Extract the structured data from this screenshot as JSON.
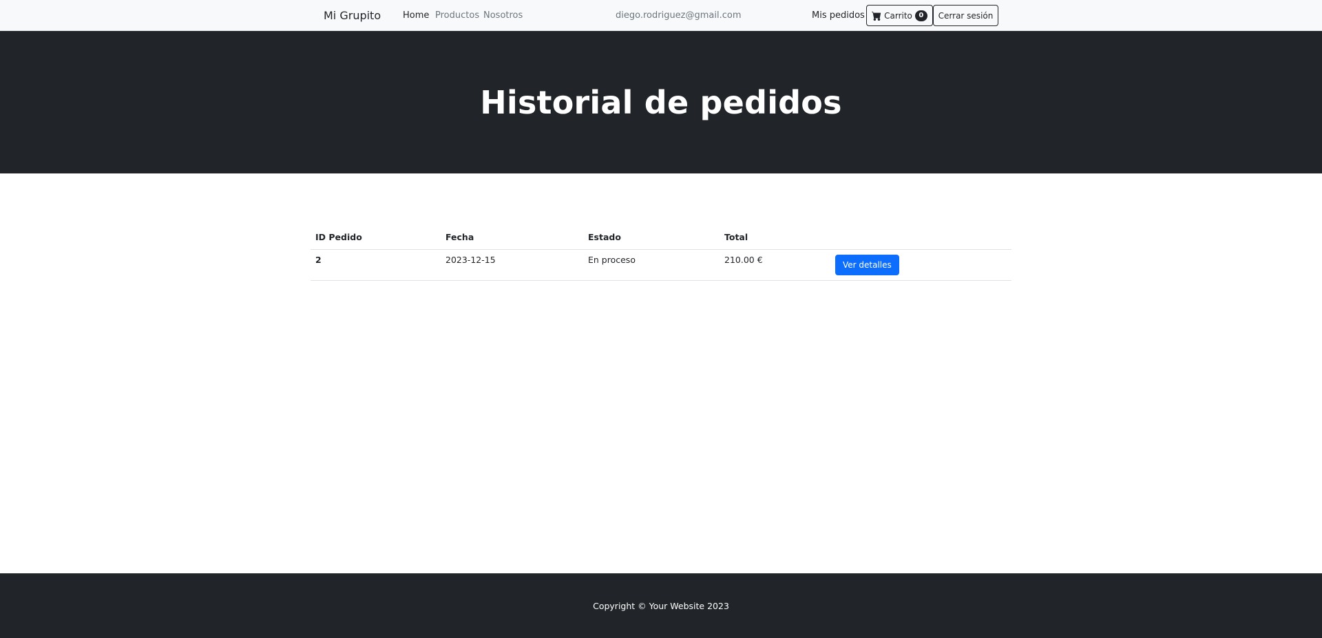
{
  "navbar": {
    "brand": "Mi Grupito",
    "links": [
      {
        "label": "Home",
        "active": true
      },
      {
        "label": "Productos",
        "active": false
      },
      {
        "label": "Nosotros",
        "active": false
      }
    ],
    "user_email": "diego.rodriguez@gmail.com",
    "orders_link": "Mis pedidos",
    "cart": {
      "label": "Carrito",
      "count": "0",
      "icon": "cart-icon"
    },
    "logout_label": "Cerrar sesión"
  },
  "header": {
    "title": "Historial de pedidos",
    "background": "#212529"
  },
  "orders_table": {
    "columns": [
      "ID Pedido",
      "Fecha",
      "Estado",
      "Total",
      ""
    ],
    "rows": [
      {
        "id": "2",
        "date": "2023-12-15",
        "status": "En proceso",
        "total": "210.00 €",
        "action_label": "Ver detalles"
      }
    ]
  },
  "footer": {
    "copyright": "Copyright © Your Website 2023"
  },
  "colors": {
    "primary": "#0d6efd",
    "dark": "#212529",
    "light": "#f8f9fa",
    "muted": "#6c757d"
  }
}
